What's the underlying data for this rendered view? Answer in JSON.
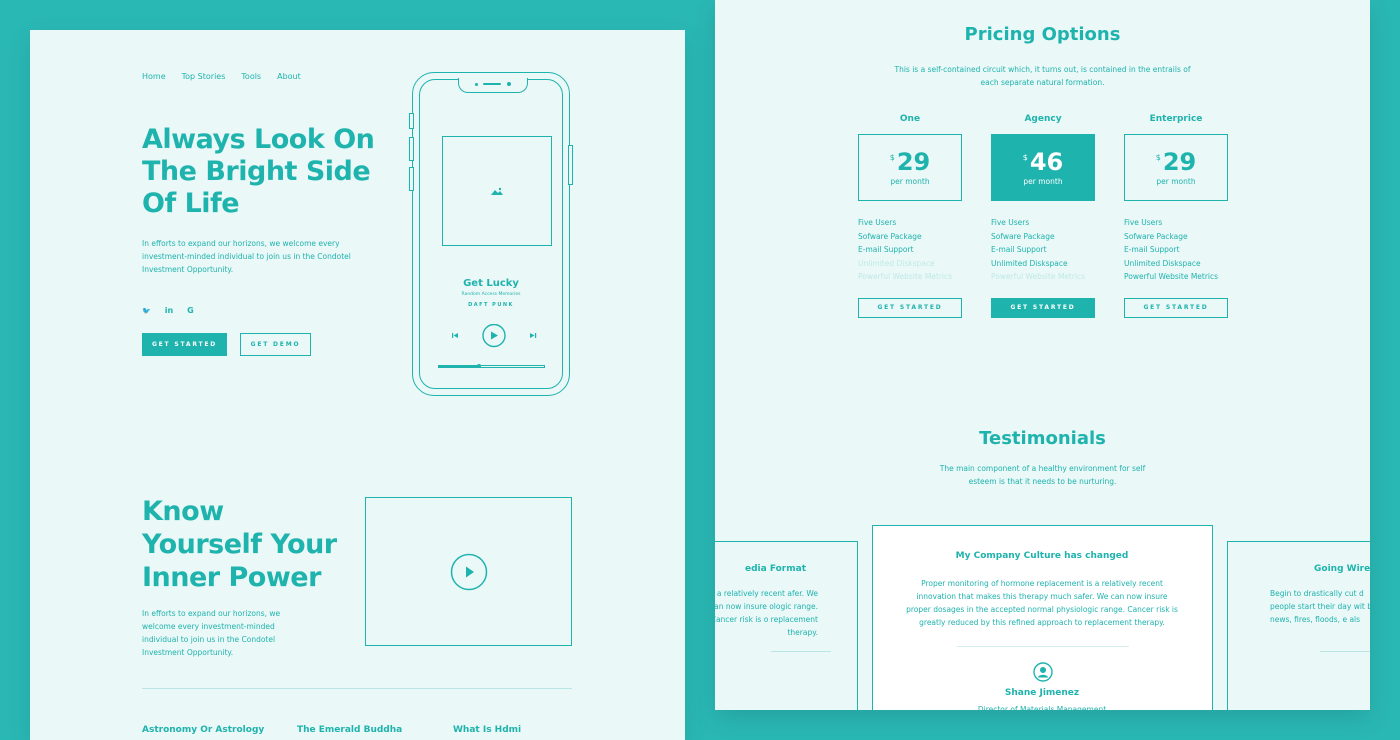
{
  "colors": {
    "background": "#2ab8b5",
    "panel": "#eaf8f7",
    "accent": "#1fb3ae",
    "muted": "#bfe9e7"
  },
  "left": {
    "nav": [
      "Home",
      "Top Stories",
      "Tools",
      "About"
    ],
    "hero": {
      "title": "Always Look On The Bright Side Of Life",
      "text": "In efforts to expand our horizons, we welcome every investment-minded individual to join us in the Condotel Investment Opportunity.",
      "social_icons": [
        "twitter-icon",
        "linkedin-icon",
        "google-icon"
      ],
      "social_glyphs": [
        "🐦",
        "in",
        "G"
      ],
      "primary_button": "GET STARTED",
      "secondary_button": "GET DEMO"
    },
    "player": {
      "song": "Get Lucky",
      "album": "Random Access Memories",
      "artist": "DAFT PUNK",
      "progress": 0.38
    },
    "section2": {
      "title": "Know Yourself Your Inner Power",
      "text": "In efforts to expand our horizons, we welcome every investment-minded individual to join us in the Condotel Investment Opportunity."
    },
    "footer_items": [
      "Astronomy Or Astrology",
      "The Emerald Buddha",
      "What Is Hdmi"
    ]
  },
  "pricing": {
    "title": "Pricing Options",
    "subtitle": "This is a self-contained circuit which, it turns out, is contained in the entrails of each separate natural formation.",
    "plans": [
      {
        "name": "One",
        "currency": "$",
        "price": "29",
        "period": "per month",
        "button": "GET STARTED",
        "features": [
          {
            "text": "Five Users",
            "enabled": true
          },
          {
            "text": "Sofware Package",
            "enabled": true
          },
          {
            "text": "E-mail Support",
            "enabled": true
          },
          {
            "text": "Unlimited Diskspace",
            "enabled": false
          },
          {
            "text": "Powerful Website Metrics",
            "enabled": false
          }
        ]
      },
      {
        "name": "Agency",
        "currency": "$",
        "price": "46",
        "period": "per month",
        "button": "GET STARTED",
        "features": [
          {
            "text": "Five Users",
            "enabled": true
          },
          {
            "text": "Sofware Package",
            "enabled": true
          },
          {
            "text": "E-mail Support",
            "enabled": true
          },
          {
            "text": "Unlimited Diskspace",
            "enabled": true
          },
          {
            "text": "Powerful Website Metrics",
            "enabled": false
          }
        ]
      },
      {
        "name": "Enterprice",
        "currency": "$",
        "price": "29",
        "period": "per month",
        "button": "GET STARTED",
        "features": [
          {
            "text": "Five Users",
            "enabled": true
          },
          {
            "text": "Sofware Package",
            "enabled": true
          },
          {
            "text": "E-mail Support",
            "enabled": true
          },
          {
            "text": "Unlimited Diskspace",
            "enabled": true
          },
          {
            "text": "Powerful Website Metrics",
            "enabled": true
          }
        ]
      }
    ]
  },
  "testimonials": {
    "title": "Testimonials",
    "subtitle": "The main component of a healthy environment for self esteem is that it needs to be nurturing.",
    "left_card": {
      "title": "edia Format",
      "text": "nt is a relatively recent afer. We can now insure ologic range. Cancer risk is o replacement therapy."
    },
    "main_card": {
      "title": "My Company Culture has changed",
      "text": "Proper monitoring of hormone replacement is a relatively recent innovation that makes this therapy much safer. We can now insure proper dosages in the accepted normal physiologic range. Cancer risk is greatly reduced by this refined approach to replacement therapy.",
      "name": "Shane Jimenez",
      "role": "Director of Materials Management"
    },
    "right_card": {
      "title": "Going Wirel",
      "text": "Begin to drastically cut d people start their day wit bad news, fires, floods, e als"
    }
  }
}
